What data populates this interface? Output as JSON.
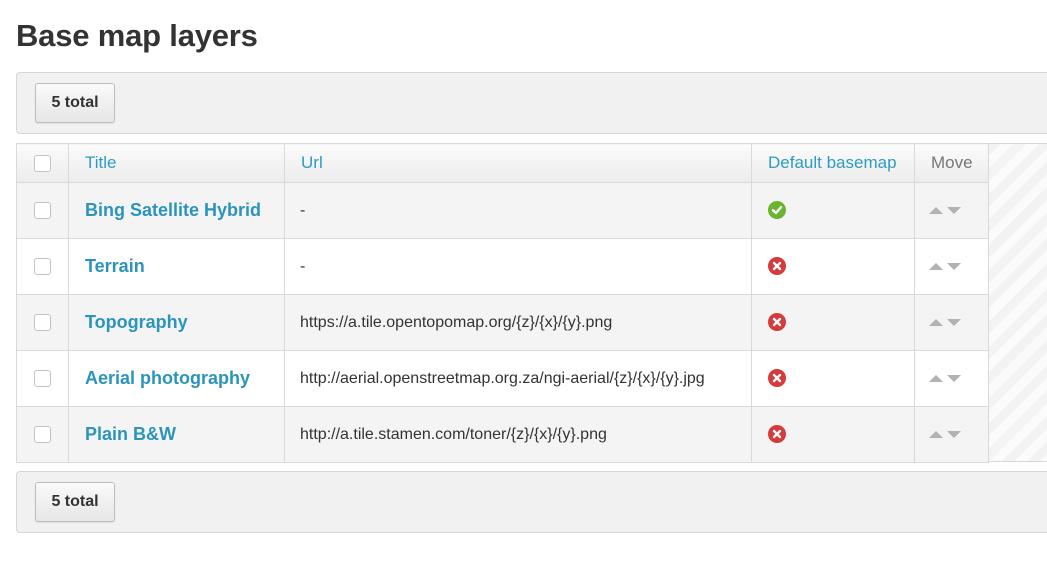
{
  "page": {
    "title": "Base map layers"
  },
  "toolbar": {
    "total_label": "5 total"
  },
  "columns": {
    "title": "Title",
    "url": "Url",
    "default": "Default basemap",
    "move": "Move"
  },
  "rows": [
    {
      "title": "Bing Satellite Hybrid",
      "url": "-",
      "default": true
    },
    {
      "title": "Terrain",
      "url": "-",
      "default": false
    },
    {
      "title": "Topography",
      "url": "https://a.tile.opentopomap.org/{z}/{x}/{y}.png",
      "default": false
    },
    {
      "title": "Aerial photography",
      "url": "http://aerial.openstreetmap.org.za/ngi-aerial/{z}/{x}/{y}.jpg",
      "default": false
    },
    {
      "title": "Plain B&W",
      "url": "http://a.tile.stamen.com/toner/{z}/{x}/{y}.png",
      "default": false
    }
  ],
  "icons": {
    "default_yes": "check-circle-icon",
    "default_no": "x-circle-icon",
    "move_up": "arrow-up-icon",
    "move_down": "arrow-down-icon"
  },
  "colors": {
    "link": "#2b94bd",
    "header_link": "#2e9bc4",
    "ok": "#6ab42f",
    "error": "#d63a3a"
  }
}
